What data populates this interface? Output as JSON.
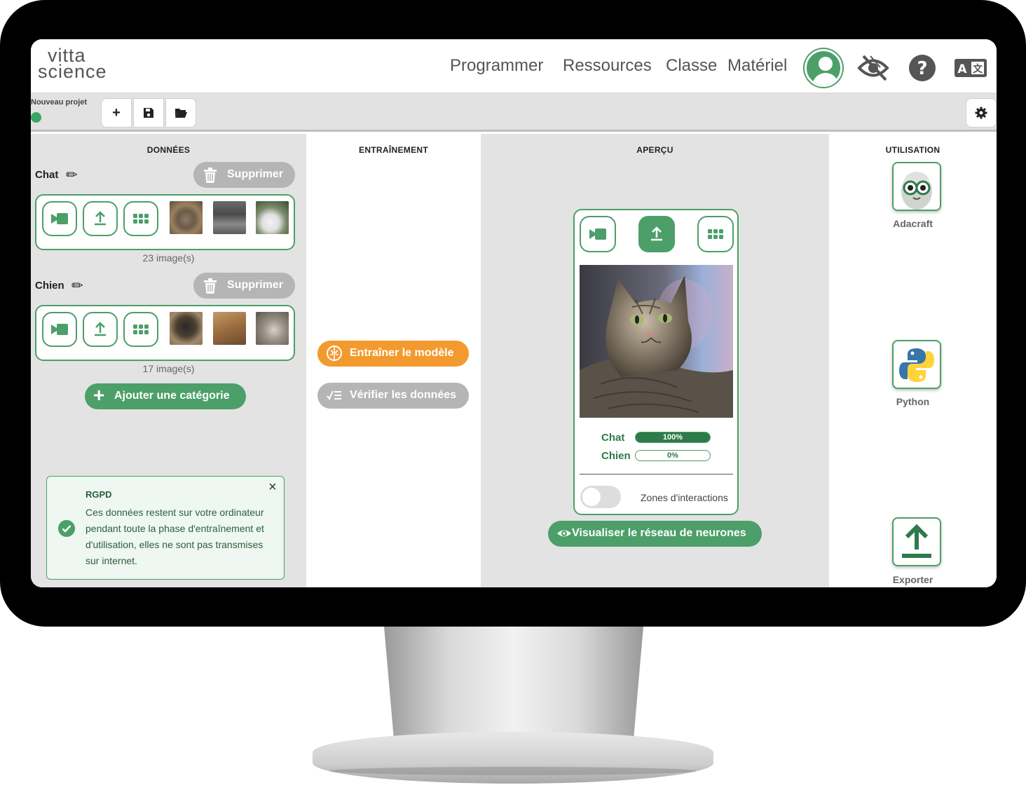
{
  "header": {
    "logo_line1": "vitta",
    "logo_line2": "science",
    "nav": [
      "Programmer",
      "Ressources",
      "Classe",
      "Matériel"
    ]
  },
  "toolbar": {
    "project_name": "Nouveau projet",
    "new_label": "+"
  },
  "columns": {
    "data": "DONNÉES",
    "training": "ENTRAÎNEMENT",
    "preview": "APERÇU",
    "usage": "UTILISATION"
  },
  "categories": [
    {
      "name": "Chat",
      "delete_label": "Supprimer",
      "count": "23 image(s)"
    },
    {
      "name": "Chien",
      "delete_label": "Supprimer",
      "count": "17 image(s)"
    }
  ],
  "add_category": "Ajouter une catégorie",
  "rgpd": {
    "title": "RGPD",
    "text": "Ces données restent sur votre ordinateur pendant toute la phase d'entraînement et d'utilisation, elles ne sont pas transmises sur internet.",
    "close": "×"
  },
  "training": {
    "train_label": "Entraîner le modèle",
    "verify_label": "Vérifier les données"
  },
  "preview": {
    "predictions": [
      {
        "label": "Chat",
        "percent": "100%",
        "value": 1.0
      },
      {
        "label": "Chien",
        "percent": "0%",
        "value": 0.0
      }
    ],
    "zones_label": "Zones d'interactions",
    "visualize_label": "Visualiser le réseau de neurones"
  },
  "usage": [
    {
      "label": "Adacraft",
      "icon": "robot-icon"
    },
    {
      "label": "Python",
      "icon": "python-icon"
    },
    {
      "label": "Exporter",
      "icon": "upload-icon"
    }
  ],
  "colors": {
    "accent": "#4c9f69",
    "dark_green": "#2e7a4b",
    "orange": "#f39a2e",
    "grey_button": "#b5b5b5"
  }
}
